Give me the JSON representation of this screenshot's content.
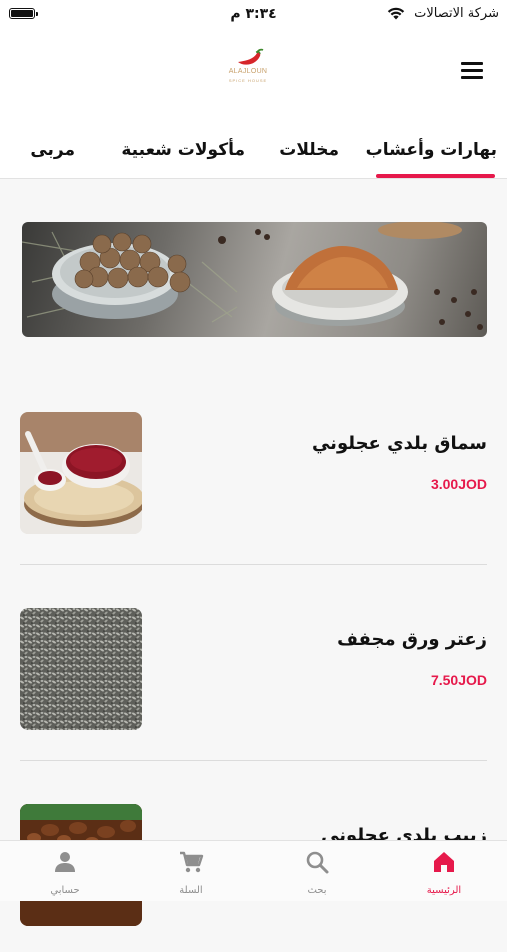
{
  "status_bar": {
    "time": "٣:٣٤ م",
    "carrier": "شركة الاتصالات"
  },
  "header": {
    "logo_text": "ALAJLOUN",
    "logo_subtext": "SPICE HOUSE"
  },
  "tabs": [
    {
      "label": "بهارات وأعشاب",
      "active": true
    },
    {
      "label": "مخللات",
      "active": false
    },
    {
      "label": "مأكولات شعبية",
      "active": false
    },
    {
      "label": "مربى",
      "active": false
    }
  ],
  "products": [
    {
      "name": "سماق بلدي عجلوني",
      "price": "3.00JOD"
    },
    {
      "name": "زعتر ورق مجفف",
      "price": "7.50JOD"
    },
    {
      "name": "زبيب بلدي عجلوني"
    }
  ],
  "bottom_nav": [
    {
      "label": "الرئيسية",
      "icon": "home-icon",
      "active": true
    },
    {
      "label": "بحث",
      "icon": "search-icon",
      "active": false
    },
    {
      "label": "السلة",
      "icon": "cart-icon",
      "active": false
    },
    {
      "label": "حسابي",
      "icon": "user-icon",
      "active": false
    }
  ],
  "colors": {
    "accent": "#e6194b",
    "nav_inactive": "#8e8e8e"
  }
}
